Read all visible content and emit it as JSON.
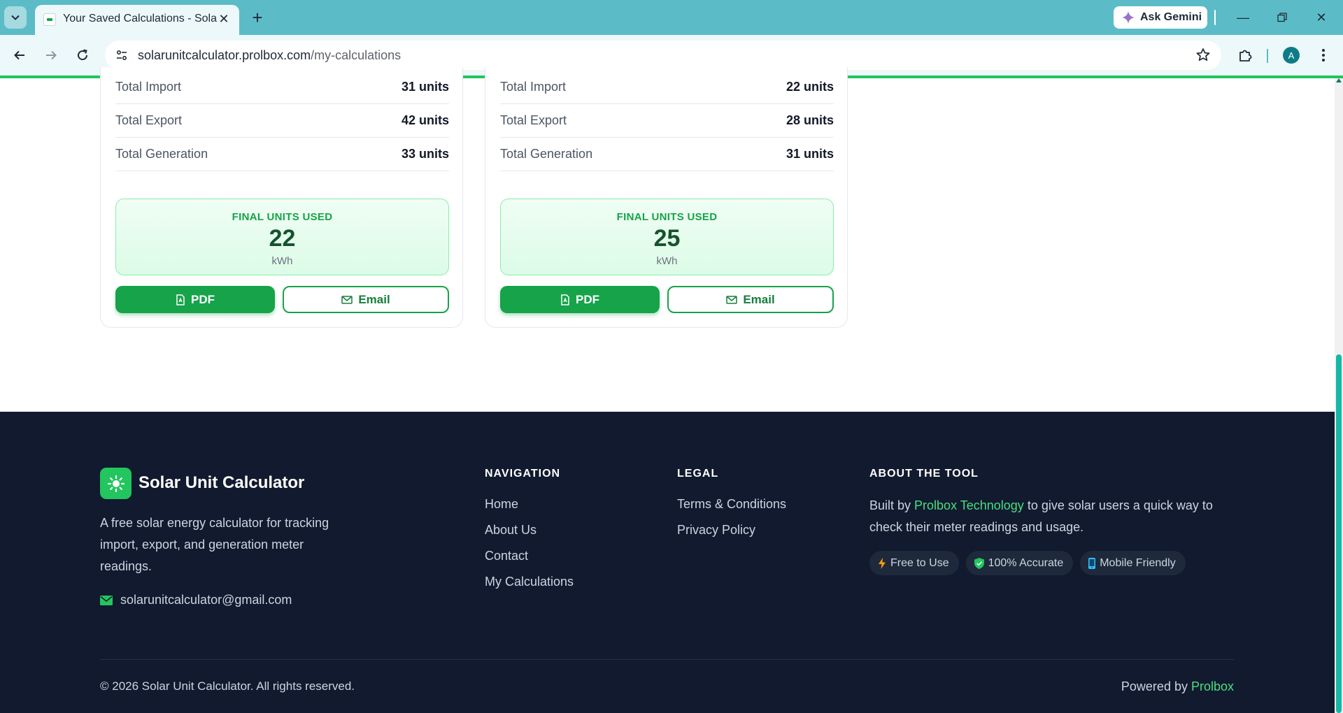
{
  "browser": {
    "tab_title": "Your Saved Calculations - Solar",
    "url_host": "solarunitcalculator.prolbox.com",
    "url_path": "/my-calculations",
    "gemini_label": "Ask Gemini",
    "avatar_letter": "A"
  },
  "cards": [
    {
      "rows": [
        {
          "label": "Total Import",
          "value": "31 units"
        },
        {
          "label": "Total Export",
          "value": "42 units"
        },
        {
          "label": "Total Generation",
          "value": "33 units"
        }
      ],
      "final_label": "FINAL UNITS USED",
      "final_value": "22",
      "final_unit": "kWh",
      "pdf_label": "PDF",
      "email_label": "Email"
    },
    {
      "rows": [
        {
          "label": "Total Import",
          "value": "22 units"
        },
        {
          "label": "Total Export",
          "value": "28 units"
        },
        {
          "label": "Total Generation",
          "value": "31 units"
        }
      ],
      "final_label": "FINAL UNITS USED",
      "final_value": "25",
      "final_unit": "kWh",
      "pdf_label": "PDF",
      "email_label": "Email"
    }
  ],
  "footer": {
    "brand_name": "Solar Unit Calculator",
    "brand_description": "A free solar energy calculator for tracking import, export, and generation meter readings.",
    "contact_email": "solarunitcalculator@gmail.com",
    "navigation": {
      "title": "NAVIGATION",
      "links": [
        "Home",
        "About Us",
        "Contact",
        "My Calculations"
      ]
    },
    "legal": {
      "title": "LEGAL",
      "links": [
        "Terms & Conditions",
        "Privacy Policy"
      ]
    },
    "about": {
      "title": "ABOUT THE TOOL",
      "text_before": "Built by ",
      "link": "Prolbox Technology",
      "text_after": " to give solar users a quick way to check their meter readings and usage.",
      "badges": [
        "Free to Use",
        "100% Accurate",
        "Mobile Friendly"
      ]
    },
    "copyright": "© 2026 Solar Unit Calculator. All rights reserved.",
    "powered_by_prefix": "Powered by ",
    "powered_by_link": "Prolbox"
  },
  "colors": {
    "chrome": "#5bbcc7",
    "accent": "#16a34a",
    "footer_bg": "#111a2e",
    "highlight": "#4ade80"
  }
}
